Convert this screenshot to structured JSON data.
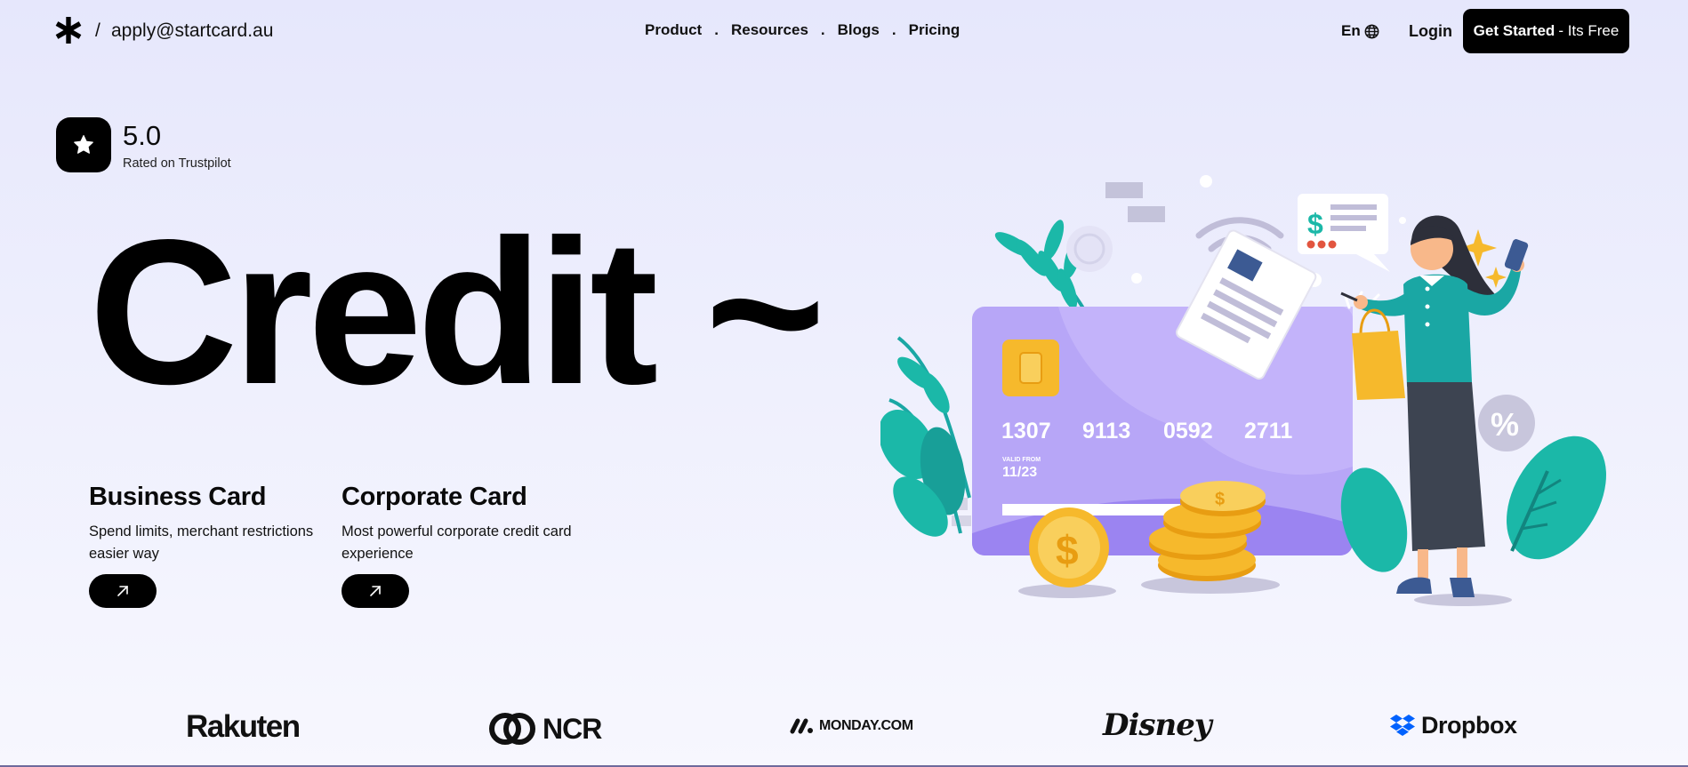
{
  "header": {
    "logo_icon": "asterisk-icon",
    "slash": "/",
    "email": "apply@startcard.au",
    "nav": [
      {
        "label": "Product"
      },
      {
        "label": "Resources"
      },
      {
        "label": "Blogs"
      },
      {
        "label": "Pricing"
      }
    ],
    "nav_separator": ".",
    "language": "En",
    "language_icon": "globe-icon",
    "login": "Login",
    "cta_strong": "Get Started",
    "cta_light": "- Its Free"
  },
  "rating": {
    "icon": "star-icon",
    "score": "5.0",
    "caption": "Rated on Trustpilot"
  },
  "hero": {
    "title": "Credit ~"
  },
  "products": [
    {
      "title": "Business Card",
      "description": "Spend limits, merchant restrictions easier way",
      "icon": "arrow-up-right-icon"
    },
    {
      "title": "Corporate Card",
      "description": "Most powerful corporate credit card experience",
      "icon": "arrow-up-right-icon"
    }
  ],
  "illustration": {
    "card_number": [
      "1307",
      "9113",
      "0592",
      "2711"
    ],
    "valid_label": "VALID FROM",
    "valid_date": "11/23",
    "dollar_sign": "$",
    "percent_sign": "%",
    "colors": {
      "card": "#b7a6f7",
      "accent": "#1bb8a8",
      "coin": "#f6b92c",
      "figure_top": "#1aa7a4",
      "figure_skirt": "#3d4451"
    }
  },
  "partners": [
    {
      "name": "Rakuten"
    },
    {
      "name": "NCR"
    },
    {
      "name": "MONDAY.COM"
    },
    {
      "name": "Disney"
    },
    {
      "name": "Dropbox"
    }
  ]
}
